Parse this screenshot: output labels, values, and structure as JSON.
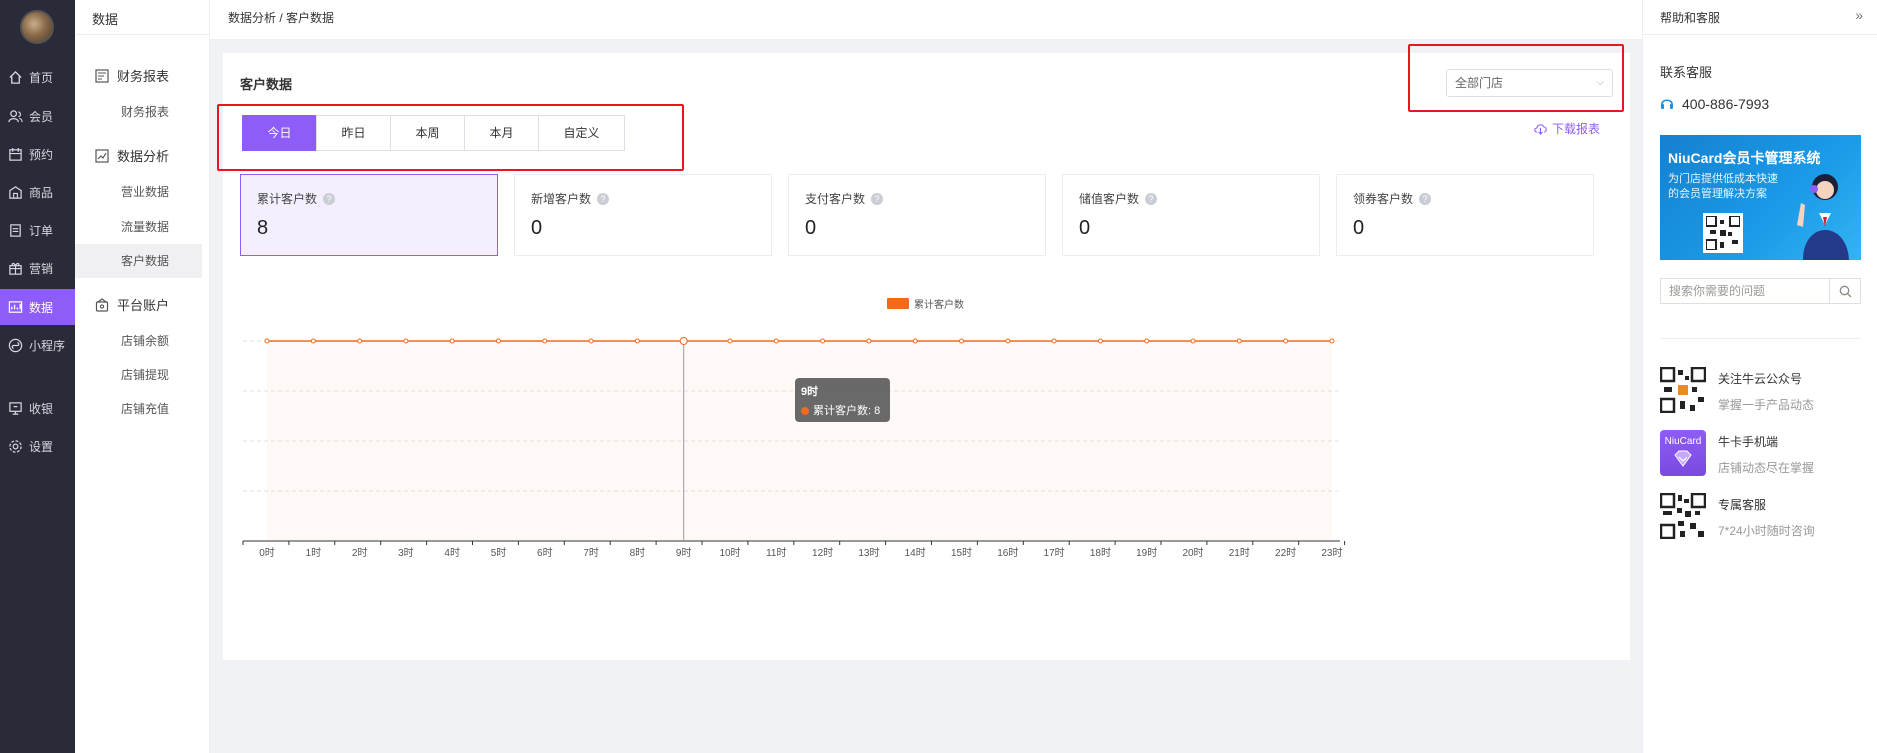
{
  "nav": {
    "items": [
      {
        "label": "首页",
        "icon": "home-icon"
      },
      {
        "label": "会员",
        "icon": "members-icon"
      },
      {
        "label": "预约",
        "icon": "booking-icon"
      },
      {
        "label": "商品",
        "icon": "goods-icon"
      },
      {
        "label": "订单",
        "icon": "order-icon"
      },
      {
        "label": "营销",
        "icon": "marketing-icon"
      },
      {
        "label": "数据",
        "icon": "data-icon",
        "active": true
      },
      {
        "label": "小程序",
        "icon": "miniprogram-icon"
      },
      {
        "label": "收银",
        "icon": "cashier-icon"
      },
      {
        "label": "设置",
        "icon": "settings-icon"
      }
    ]
  },
  "submenu": {
    "title": "数据",
    "groups": [
      {
        "label": "财务报表",
        "items": [
          "财务报表"
        ]
      },
      {
        "label": "数据分析",
        "items": [
          "营业数据",
          "流量数据",
          "客户数据"
        ]
      },
      {
        "label": "平台账户",
        "items": [
          "店铺余额",
          "店铺提现",
          "店铺充值"
        ]
      }
    ],
    "active_item": "客户数据"
  },
  "header": {
    "breadcrumb": "数据分析 / 客户数据"
  },
  "main": {
    "title": "客户数据",
    "store_select": "全部门店",
    "tabs": [
      "今日",
      "昨日",
      "本周",
      "本月",
      "自定义"
    ],
    "active_tab": "今日",
    "download": "下载报表",
    "cards": [
      {
        "label": "累计客户数",
        "value": "8",
        "active": true
      },
      {
        "label": "新增客户数",
        "value": "0"
      },
      {
        "label": "支付客户数",
        "value": "0"
      },
      {
        "label": "储值客户数",
        "value": "0"
      },
      {
        "label": "领券客户数",
        "value": "0"
      }
    ],
    "tooltip": {
      "title": "9时",
      "series": "累计客户数",
      "value": "8"
    }
  },
  "chart_data": {
    "type": "area",
    "categories": [
      "0时",
      "1时",
      "2时",
      "3时",
      "4时",
      "5时",
      "6时",
      "7时",
      "8时",
      "9时",
      "10时",
      "11时",
      "12时",
      "13时",
      "14时",
      "15时",
      "16时",
      "17时",
      "18时",
      "19时",
      "20时",
      "21时",
      "22时",
      "23时"
    ],
    "series": [
      {
        "name": "累计客户数",
        "values": [
          8,
          8,
          8,
          8,
          8,
          8,
          8,
          8,
          8,
          8,
          8,
          8,
          8,
          8,
          8,
          8,
          8,
          8,
          8,
          8,
          8,
          8,
          8,
          8
        ]
      }
    ],
    "ylim": [
      0,
      8
    ],
    "yticks": [
      0,
      2,
      4,
      6,
      8
    ],
    "grid": true,
    "legend": "top-center",
    "color": "#f26a1b"
  },
  "help": {
    "title": "帮助和客服",
    "contact_title": "联系客服",
    "phone": "400-886-7993",
    "banner": {
      "title": "NiuCard会员卡管理系统",
      "subtitle": "为门店提供低成本快速的会员管理解决方案"
    },
    "search_placeholder": "搜索你需要的问题",
    "items": [
      {
        "title": "关注牛云公众号",
        "sub": "掌握一手产品动态"
      },
      {
        "title": "牛卡手机端",
        "sub": "店铺动态尽在掌握",
        "thumb_text": "NiuCard"
      },
      {
        "title": "专属客服",
        "sub": "7*24小时随时咨询"
      }
    ]
  },
  "colors": {
    "accent": "#8e5cf6",
    "line": "#f26a1b",
    "highlight": "#e8161e"
  }
}
